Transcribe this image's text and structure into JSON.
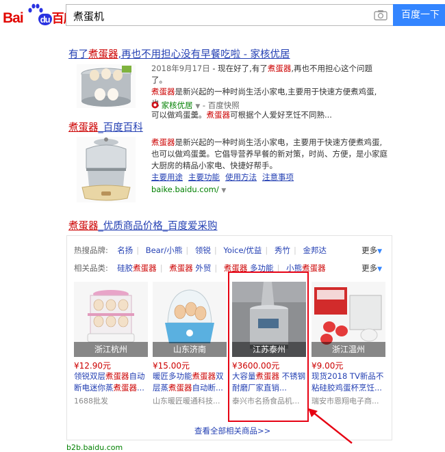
{
  "header": {
    "logo_text_left": "Bai",
    "logo_text_mid": "du",
    "logo_text_right": "百度",
    "query": "煮蛋机",
    "search_button": "百度一下"
  },
  "results": [
    {
      "title_pre": "有了",
      "title_em": "煮蛋器",
      "title_post": ",再也不用担心没有早餐吃啦 - 家核优居",
      "date": "2018年9月17日",
      "abs_1": " - 现在好了,有了",
      "abs_1_em": "煮蛋器",
      "abs_1_post": ",再也不用担心这个问题了。",
      "abs_2_em": "煮蛋器",
      "abs_2": "是新兴起的一种时尚生活小家电,主要用于快速方便煮鸡蛋,也",
      "abs_3": "可以做鸡蛋羹。",
      "abs_3_em": "煮蛋器",
      "abs_3_post": "可根据个人爱好烹饪不同熟...",
      "source": "家核优居",
      "snapshot": "- 百度快照"
    },
    {
      "title_em": "煮蛋器",
      "title_post": "_百度百科",
      "abs_1_em": "煮蛋器",
      "abs_1": "是新兴起的一种时尚生活小家电，主要用于快速方便煮鸡蛋,",
      "abs_2": "也可以做鸡蛋羹。它倡导营养早餐的新对策，时尚、方便，是小家庭",
      "abs_3": "大厨房的精品小家电、快捷好帮手。",
      "links": [
        "主要用途",
        "主要功能",
        "使用方法",
        "注意事项"
      ],
      "url": "baike.baidu.com/"
    }
  ],
  "shopping": {
    "title_em": "煮蛋器",
    "title_post": "_优质商品价格_百度爱采购",
    "brand_label": "热搜品牌:",
    "brands": [
      "名扬",
      "Bear/小熊",
      "领锐",
      "Yoice/优益",
      "秀竹",
      "金邦达"
    ],
    "cat_label": "相关品类:",
    "cats": [
      {
        "pre": "硅胶",
        "em": "煮蛋器",
        "post": ""
      },
      {
        "pre": "",
        "em": "煮蛋器",
        "post": " 外贸"
      },
      {
        "pre": "",
        "em": "煮蛋器",
        "post": " 多功能"
      },
      {
        "pre": "小熊",
        "em": "煮蛋器",
        "post": ""
      }
    ],
    "more": "更多",
    "products": [
      {
        "loc": "浙江杭州",
        "price": "¥12.90元",
        "name_pre": "领锐双层",
        "name_em": "煮蛋器",
        "name_post": "自动断电迷你蒸",
        "name_em2": "煮蛋器",
        "name_post2": "...",
        "shop": "1688批发"
      },
      {
        "loc": "山东济南",
        "price": "¥15.00元",
        "name_pre": "暖匠多功能",
        "name_em": "煮蛋器",
        "name_post": "双层蒸",
        "name_em2": "煮蛋器",
        "name_post2": "自动断...",
        "shop": "山东暖匠暖通科技..."
      },
      {
        "loc": "江苏泰州",
        "price": "¥3600.00元",
        "name_pre": "大容量",
        "name_em": "煮蛋器",
        "name_post": " 不锈钢耐磨厂家直销...",
        "name_em2": "",
        "name_post2": "",
        "shop": "泰兴市名扬食品机..."
      },
      {
        "loc": "浙江温州",
        "price": "¥9.00元",
        "name_pre": "现货2018 TV新品不粘硅胶鸡蛋杯烹饪...",
        "name_em": "",
        "name_post": "",
        "name_em2": "",
        "name_post2": "",
        "shop": "瑞安市恩翔电子商..."
      }
    ],
    "view_all": "查看全部相关商品>>",
    "bottom_url": "b2b.baidu.com"
  },
  "colors": {
    "brand_red": "#e10601",
    "link_blue": "#2440b3",
    "button_blue": "#3385ff",
    "highlight": "#e60012"
  }
}
